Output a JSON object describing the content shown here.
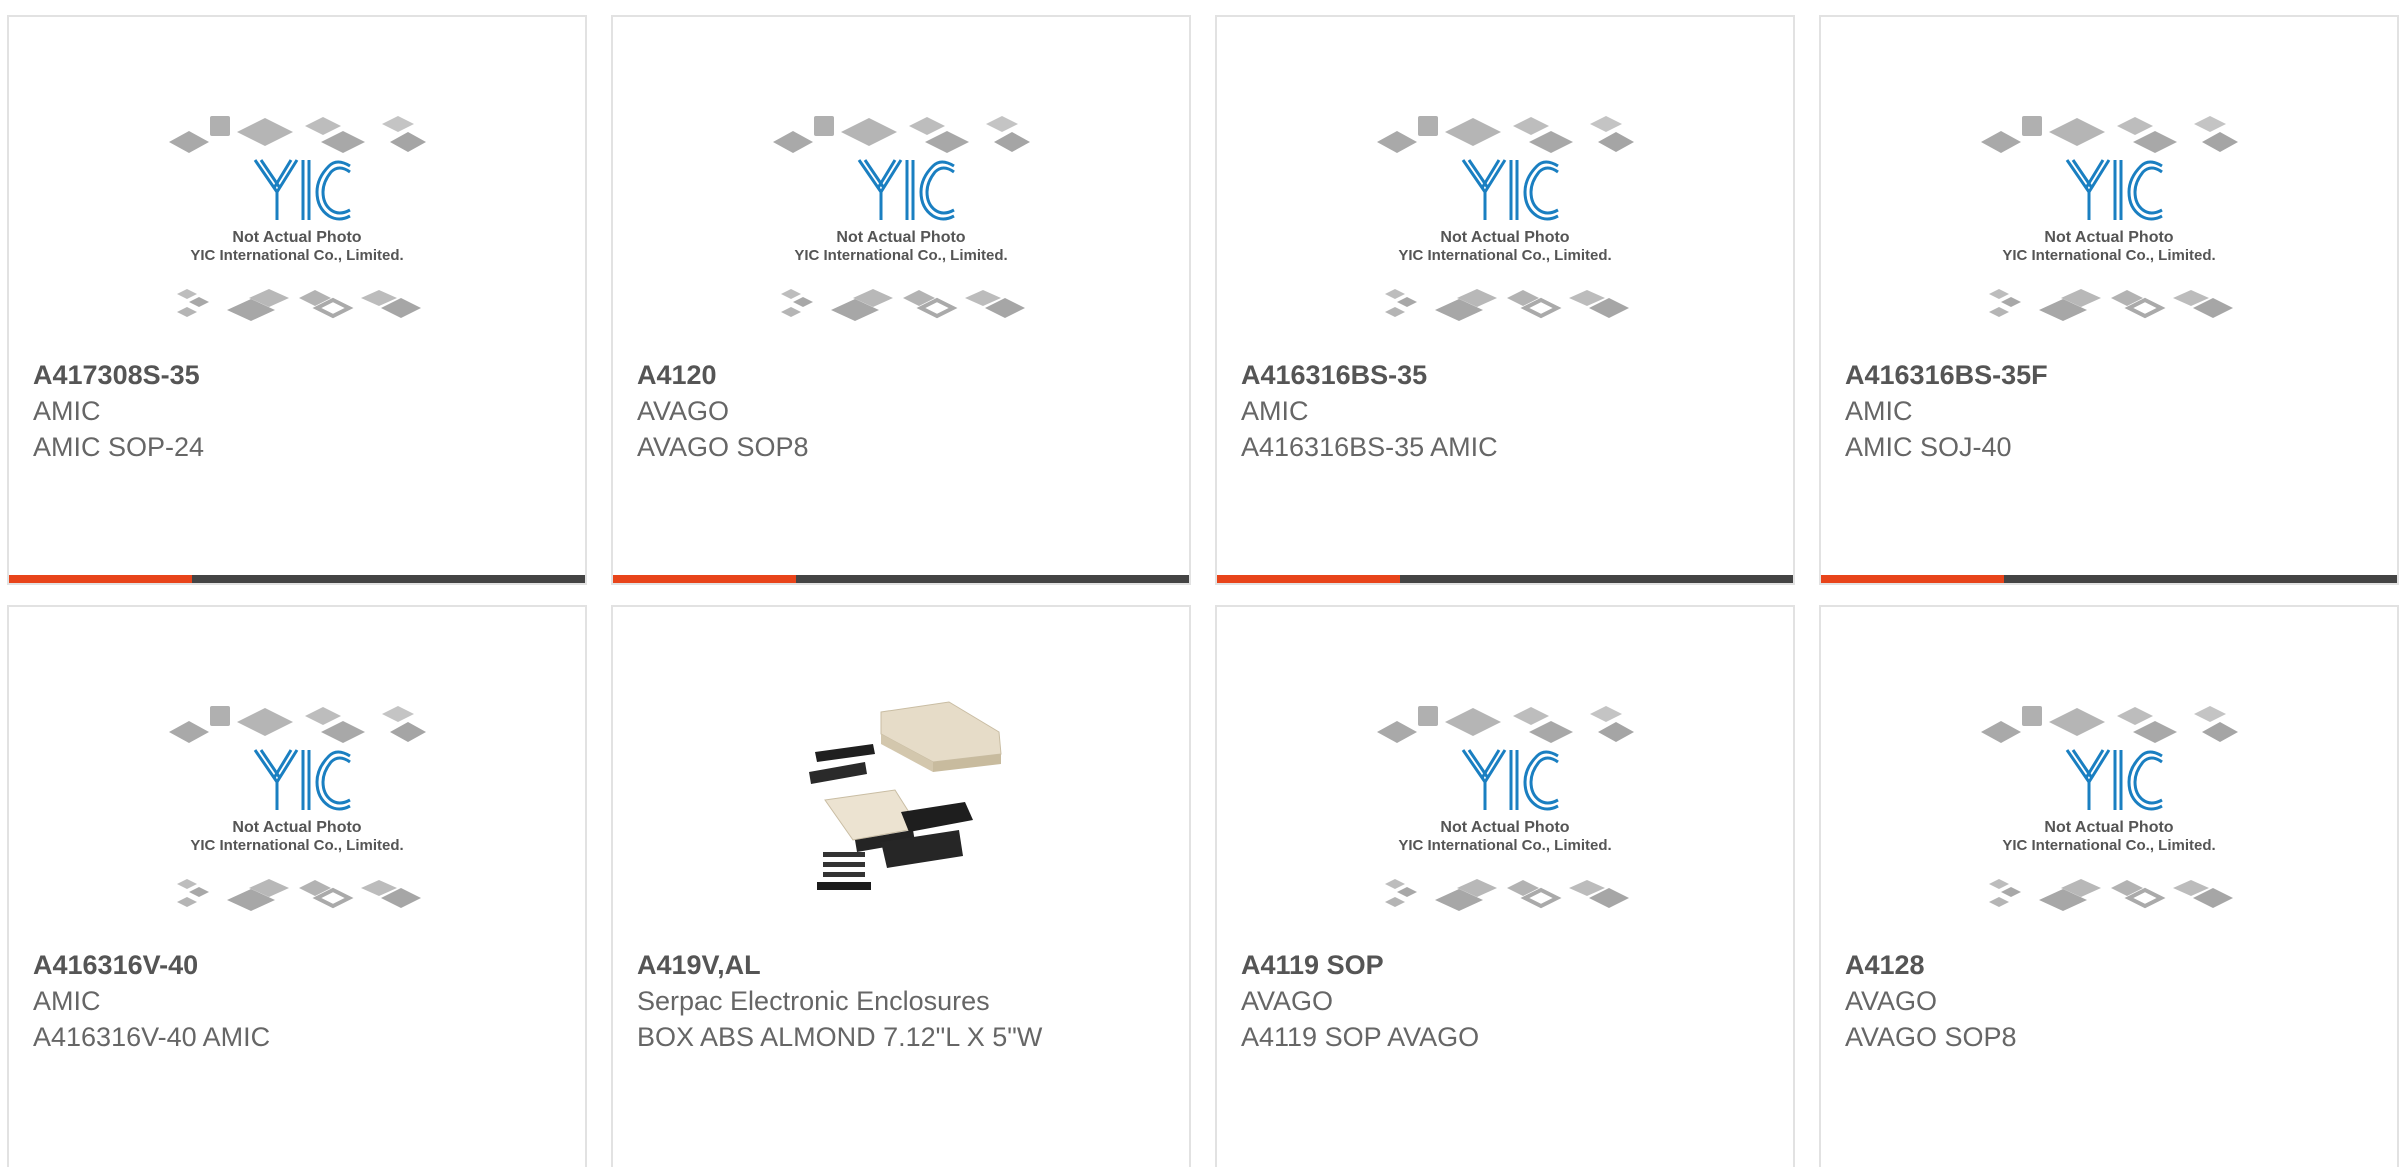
{
  "products": [
    {
      "part": "A417308S-35",
      "maker": "AMIC",
      "desc": "AMIC SOP-24",
      "image": "placeholder"
    },
    {
      "part": "A4120",
      "maker": "AVAGO",
      "desc": "AVAGO SOP8",
      "image": "placeholder"
    },
    {
      "part": "A416316BS-35",
      "maker": "AMIC",
      "desc": "A416316BS-35 AMIC",
      "image": "placeholder"
    },
    {
      "part": "A416316BS-35F",
      "maker": "AMIC",
      "desc": "AMIC SOJ-40",
      "image": "placeholder"
    },
    {
      "part": "A416316V-40",
      "maker": "AMIC",
      "desc": "A416316V-40 AMIC",
      "image": "placeholder"
    },
    {
      "part": "A419V,AL",
      "maker": "Serpac Electronic Enclosures",
      "desc": "BOX ABS ALMOND 7.12\"L X 5\"W",
      "image": "enclosure"
    },
    {
      "part": "A4119 SOP",
      "maker": "AVAGO",
      "desc": "A4119 SOP AVAGO",
      "image": "placeholder"
    },
    {
      "part": "A4128",
      "maker": "AVAGO",
      "desc": "AVAGO SOP8",
      "image": "placeholder"
    }
  ],
  "placeholder": {
    "logo_text": "YIC",
    "line1": "Not Actual Photo",
    "line2": "YIC International Co., Limited."
  },
  "colors": {
    "accent": "#e8441a",
    "bar": "#444444",
    "logo_blue": "#1a7fc1",
    "border": "#e2e2e2"
  }
}
